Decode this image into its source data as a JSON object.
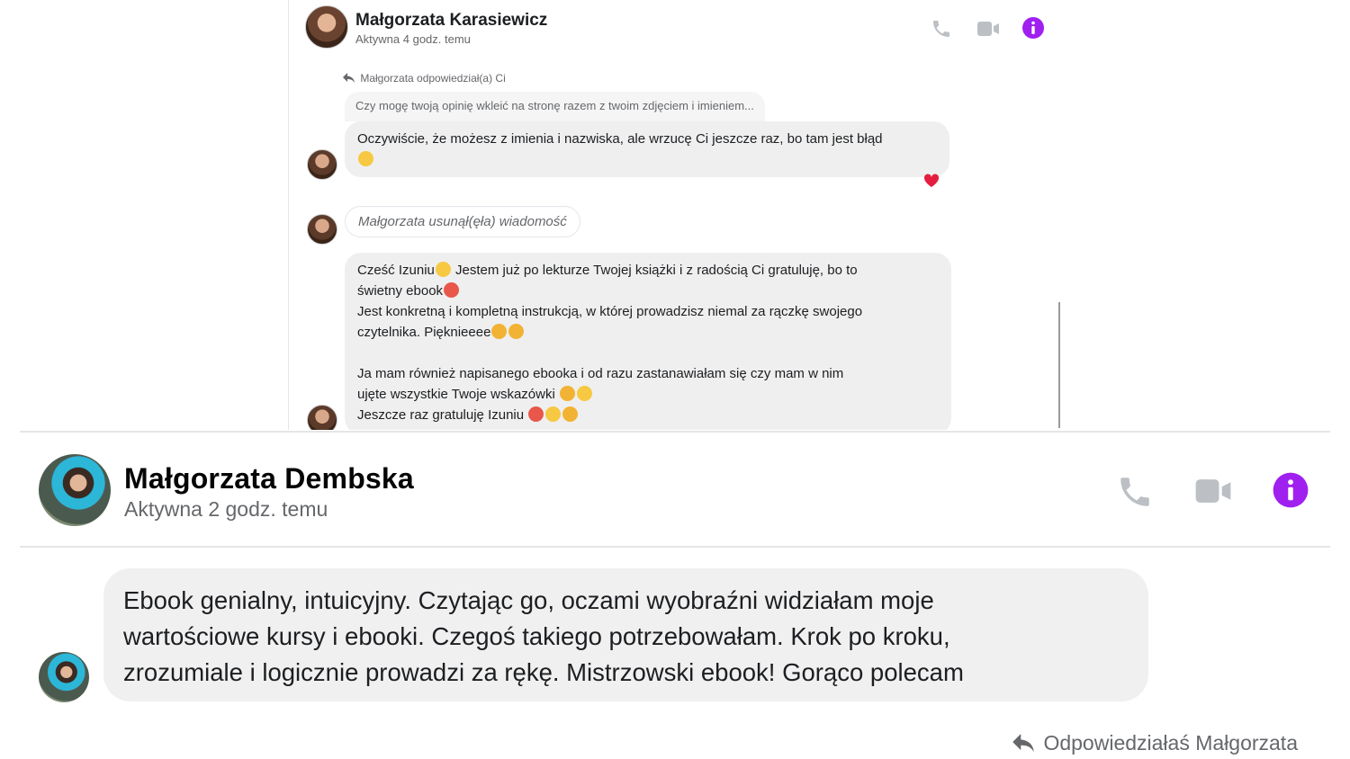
{
  "top_chat": {
    "contact_name": "Małgorzata Karasiewicz",
    "status": "Aktywna 4 godz. temu",
    "replied_label": "Małgorzata odpowiedział(a) Ci",
    "quoted_message": "Czy mogę twoją opinię wkleić na stronę razem z twoim zdjęciem i imieniem...",
    "reply_message_line1": "Oczywiście, że możesz z imienia i nazwiska, ale wrzucę Ci jeszcze raz, bo tam jest błąd",
    "deleted_message": "Małgorzata usunął(ęła) wiadomość",
    "long_message": {
      "line1": "Cześć Izuniu",
      "line1b": " Jestem już po lekturze Twojej książki i z radością Ci gratuluję, bo to",
      "line2": "świetny  ebook",
      "line3": "Jest konkretną i kompletną instrukcją, w której prowadzisz niemal za rączkę swojego",
      "line4": "czytelnika. Pięknieeee",
      "line5": "Ja mam również napisanego ebooka i od razu zastanawiałam się czy mam w nim",
      "line6": "ujęte wszystkie Twoje wskazówki ",
      "line7": "Jeszcze raz gratuluję Izuniu "
    },
    "icons": [
      "phone-icon",
      "video-icon",
      "info-icon"
    ]
  },
  "bottom_chat": {
    "contact_name": "Małgorzata Dembska",
    "status": "Aktywna 2 godz. temu",
    "message_line1": "Ebook genialny, intuicyjny. Czytając go, oczami wyobraźni widziałam moje",
    "message_line2": "wartościowe kursy i ebooki. Czegoś takiego potrzebowałam. Krok po kroku,",
    "message_line3": "zrozumiale  i logicznie prowadzi za rękę. Mistrzowski ebook! Gorąco polecam",
    "replied_label": "Odpowiedziałaś Małgorzata",
    "icons": [
      "phone-icon",
      "video-icon",
      "info-icon"
    ]
  },
  "colors": {
    "accent": "#a020f0",
    "icon_gray": "#bcc0c4",
    "bubble": "#f0f0f0",
    "secondary_text": "#65676b"
  }
}
